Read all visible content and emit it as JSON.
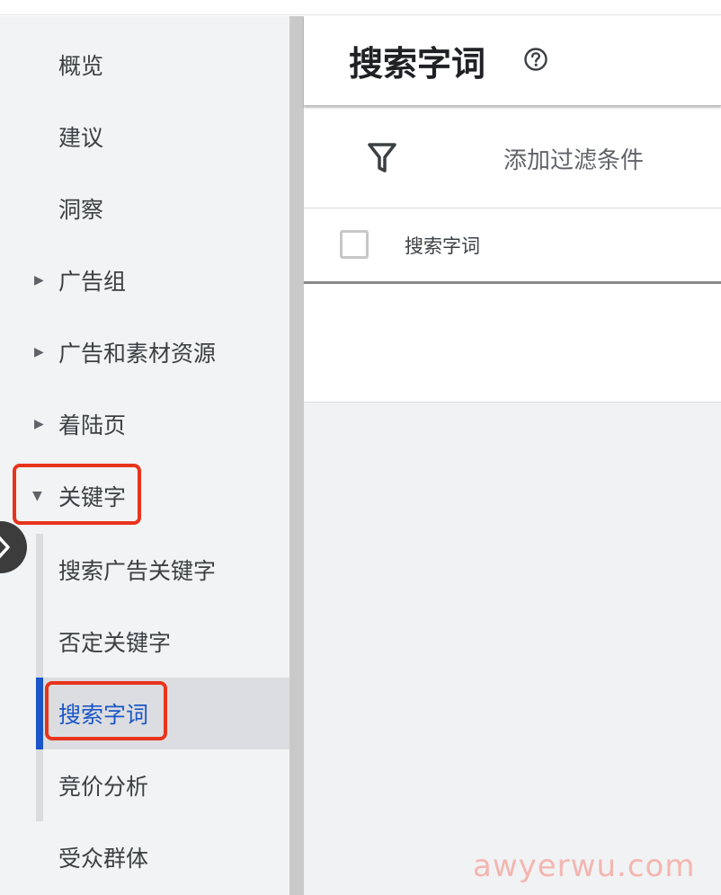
{
  "sidebar": {
    "items": [
      {
        "label": "概览",
        "has_arrow": false
      },
      {
        "label": "建议",
        "has_arrow": false
      },
      {
        "label": "洞察",
        "has_arrow": false
      },
      {
        "label": "广告组",
        "has_arrow": true
      },
      {
        "label": "广告和素材资源",
        "has_arrow": true
      },
      {
        "label": "着陆页",
        "has_arrow": true
      },
      {
        "label": "关键字",
        "has_arrow": true,
        "expanded": true
      }
    ],
    "sub_items": [
      {
        "label": "搜索广告关键字"
      },
      {
        "label": "否定关键字"
      },
      {
        "label": "搜索字词",
        "active": true
      },
      {
        "label": "竞价分析"
      }
    ],
    "after_items": [
      {
        "label": "受众群体"
      }
    ],
    "icons": {
      "collapsed_arrow": "caret-right-icon",
      "expanded_arrow": "caret-down-icon",
      "expand_button": "chevron-right-icon"
    }
  },
  "main": {
    "title": "搜索字词",
    "help_icon": "help-circle-icon",
    "filter": {
      "label": "添加过滤条件",
      "icon": "filter-icon"
    },
    "table": {
      "columns": [
        "搜索字词"
      ]
    }
  },
  "watermark": "awyerwu.com",
  "colors": {
    "accent": "#1a56c9",
    "highlight": "#e8341c",
    "sidebar_bg": "#f1f3f4"
  }
}
